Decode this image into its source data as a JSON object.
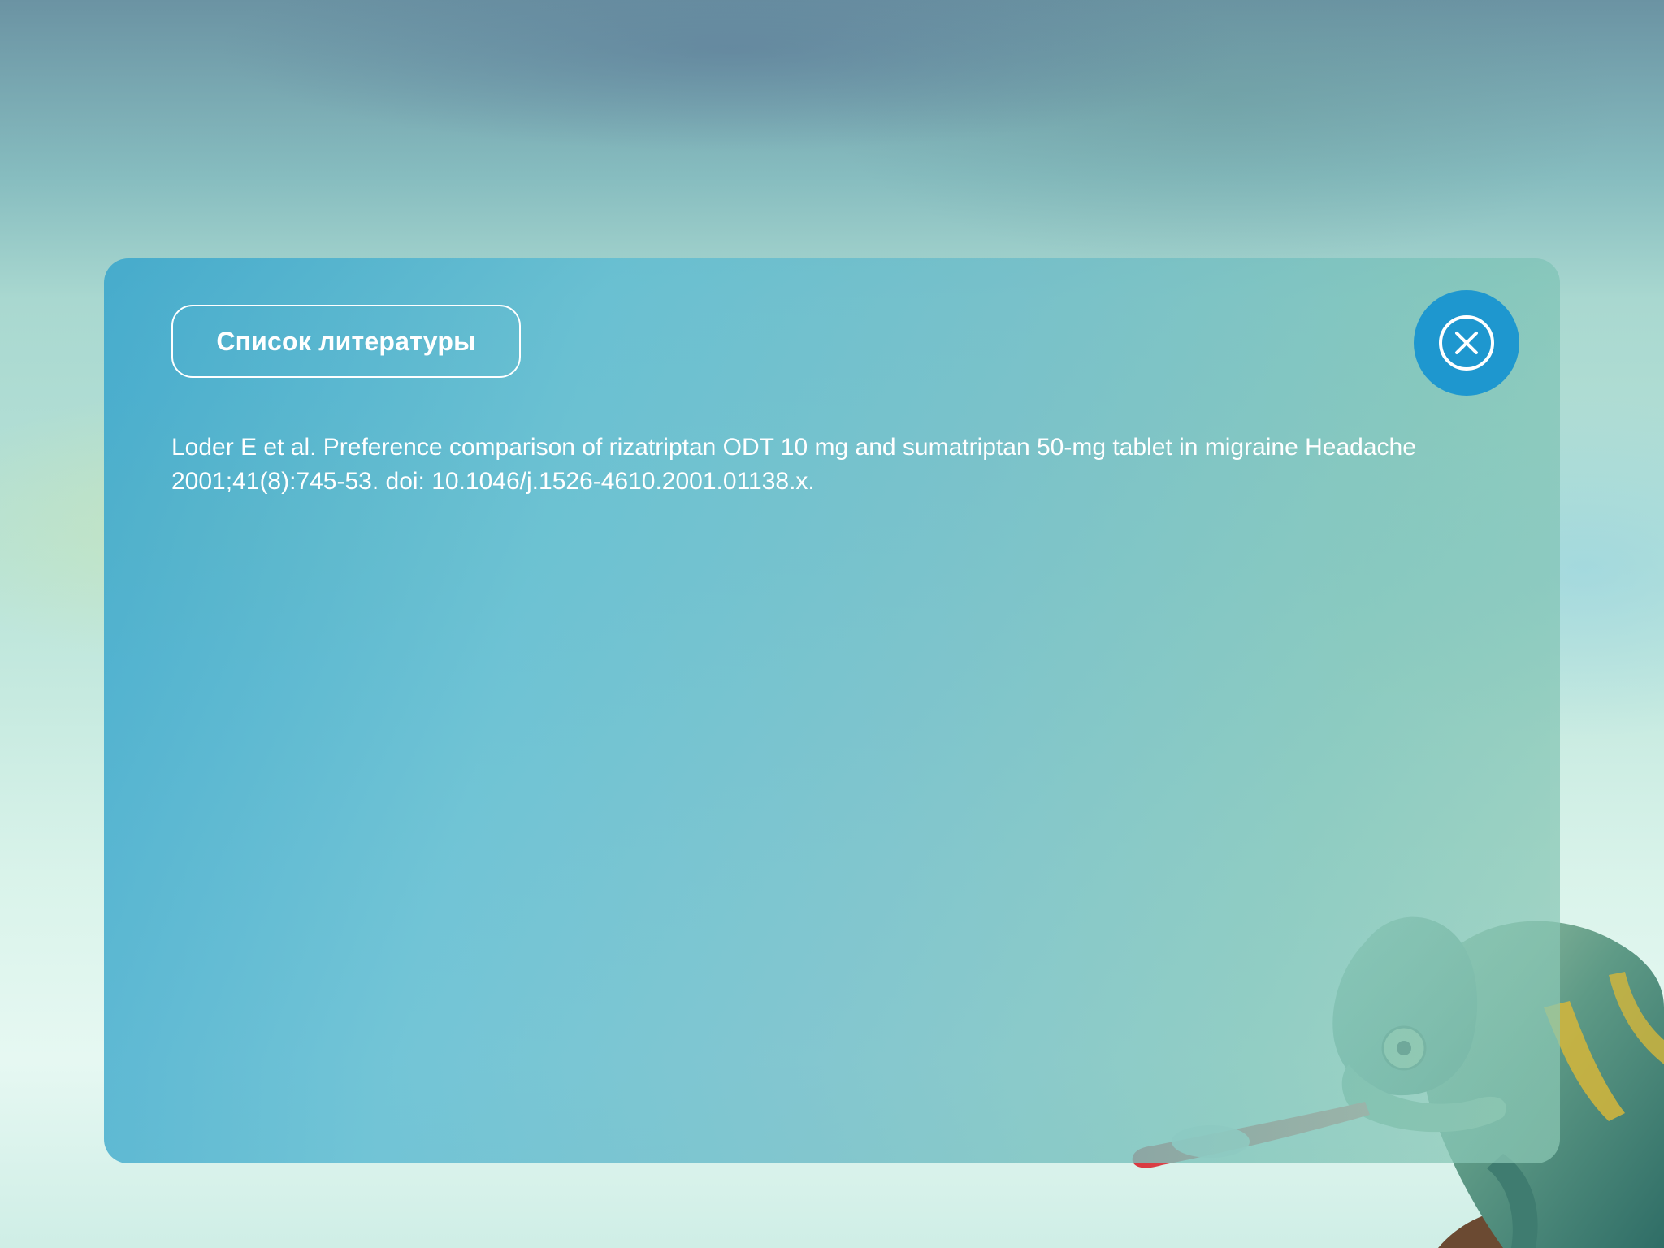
{
  "modal": {
    "title": "Список литературы",
    "reference_text": "Loder E et al. Preference comparison of rizatriptan ODT 10 mg and sumatriptan 50-mg tablet in migraine Headache 2001;41(8):745-53. doi: 10.1046/j.1526-4610.2001.01138.x.",
    "close_icon": "close-circle-icon"
  },
  "colors": {
    "accent": "#1e97cf",
    "text": "#ffffff"
  }
}
